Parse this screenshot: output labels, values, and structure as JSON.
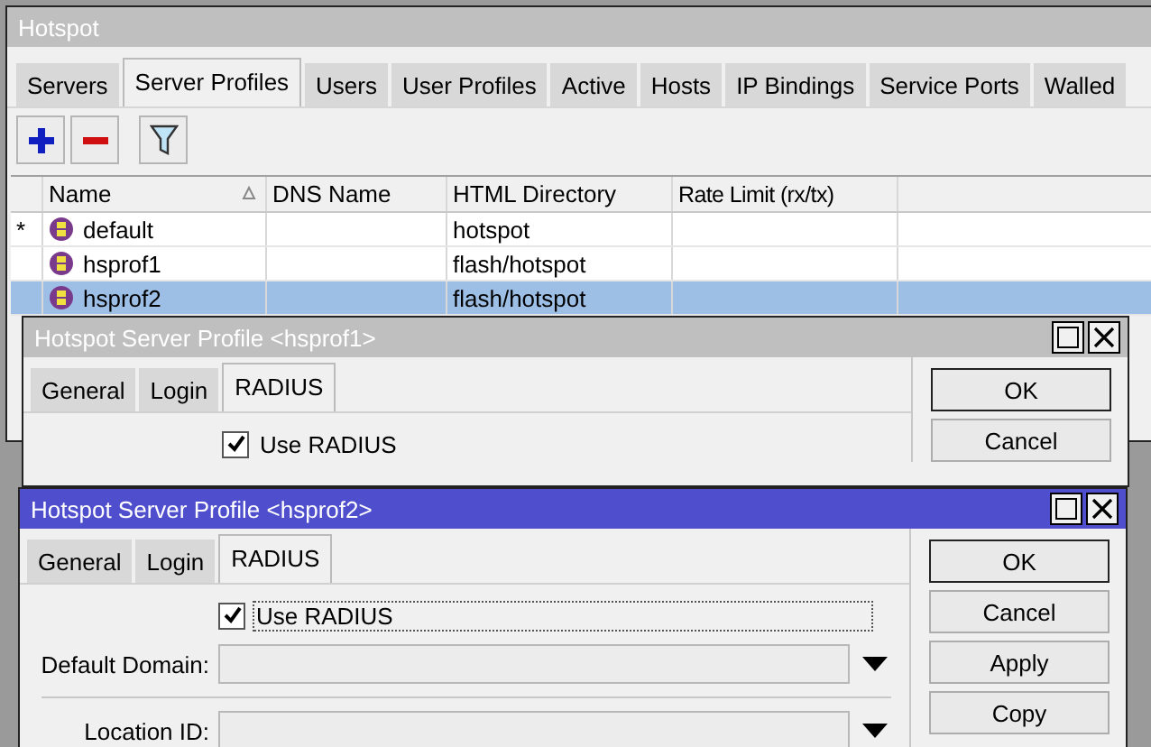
{
  "main_window": {
    "title": "Hotspot",
    "tabs": [
      {
        "label": "Servers",
        "selected": false
      },
      {
        "label": "Server Profiles",
        "selected": true
      },
      {
        "label": "Users",
        "selected": false
      },
      {
        "label": "User Profiles",
        "selected": false
      },
      {
        "label": "Active",
        "selected": false
      },
      {
        "label": "Hosts",
        "selected": false
      },
      {
        "label": "IP Bindings",
        "selected": false
      },
      {
        "label": "Service Ports",
        "selected": false
      },
      {
        "label": "Walled",
        "selected": false
      }
    ],
    "table": {
      "columns": [
        "Name",
        "DNS Name",
        "HTML Directory",
        "Rate Limit (rx/tx)"
      ],
      "rows": [
        {
          "marker": "*",
          "name": "default",
          "html_directory": "hotspot",
          "selected": false
        },
        {
          "name": "hsprof1",
          "html_directory": "flash/hotspot",
          "selected": false
        },
        {
          "name": "hsprof2",
          "html_directory": "flash/hotspot",
          "selected": true
        }
      ]
    }
  },
  "dialogs": [
    {
      "title": "Hotspot Server Profile <hsprof1>",
      "active": false,
      "tabs": [
        {
          "label": "General",
          "selected": false
        },
        {
          "label": "Login",
          "selected": false
        },
        {
          "label": "RADIUS",
          "selected": true
        }
      ],
      "use_radius": {
        "label": "Use RADIUS",
        "checked": true,
        "focused": false
      },
      "buttons": [
        "OK",
        "Cancel"
      ]
    },
    {
      "title": "Hotspot Server Profile <hsprof2>",
      "active": true,
      "tabs": [
        {
          "label": "General",
          "selected": false
        },
        {
          "label": "Login",
          "selected": false
        },
        {
          "label": "RADIUS",
          "selected": true
        }
      ],
      "use_radius": {
        "label": "Use RADIUS",
        "checked": true,
        "focused": true
      },
      "fields": [
        {
          "label": "Default Domain:"
        },
        {
          "label": "Location ID:"
        }
      ],
      "buttons": [
        "OK",
        "Cancel",
        "Apply",
        "Copy"
      ]
    }
  ]
}
